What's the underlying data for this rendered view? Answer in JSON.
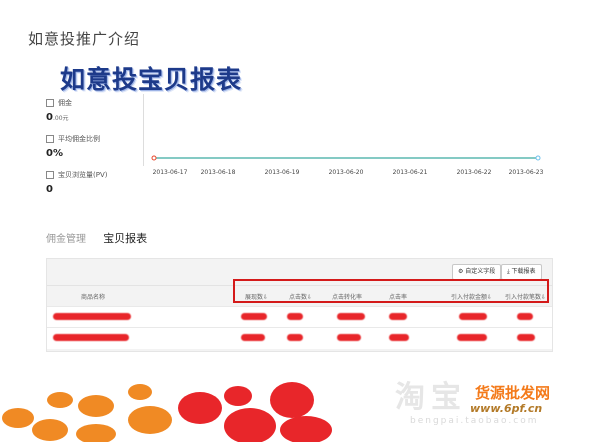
{
  "slide": {
    "title": "如意投推广介绍",
    "report_title": "如意投宝贝报表"
  },
  "metrics": [
    {
      "label": "佣金",
      "value": "0",
      "unit": ".00元"
    },
    {
      "label": "平均佣金比例",
      "value": "0%",
      "unit": ""
    },
    {
      "label": "宝贝浏览量(PV)",
      "value": "0",
      "unit": ""
    }
  ],
  "chart_data": {
    "type": "line",
    "x": [
      "2013-06-17",
      "2013-06-18",
      "2013-06-19",
      "2013-06-20",
      "2013-06-21",
      "2013-06-22",
      "2013-06-23"
    ],
    "series": [
      {
        "values": [
          0,
          0,
          0,
          0,
          0,
          0,
          0
        ],
        "color": "#5bb8b0"
      }
    ],
    "start_marker_color": "#e8462a",
    "end_marker_color": "#6cc0ec",
    "ylim": [
      0,
      1
    ],
    "grid": false
  },
  "tabs": [
    {
      "label": "佣金管理",
      "active": false
    },
    {
      "label": "宝贝报表",
      "active": true
    }
  ],
  "table": {
    "buttons": {
      "custom_fields": "⚙ 自定义字段",
      "download": "⤓ 下载报表"
    },
    "columns": [
      "商品名称",
      "展现数⇩",
      "点击数⇩",
      "点击转化率",
      "点击率",
      "引入付款金额⇩",
      "引入付款笔数⇩"
    ],
    "rows_note_redacted": true,
    "highlight_color": "#d41a1a"
  },
  "watermark": {
    "chars": "淘宝",
    "domain_faint": "bengpai.taobao.com",
    "brand_cn": "货源批发网",
    "brand_url": "www.6pf.cn"
  },
  "colors": {
    "title_blue": "#1d3a8a",
    "bubble_orange": "#f08a24",
    "bubble_red": "#e8262a"
  }
}
